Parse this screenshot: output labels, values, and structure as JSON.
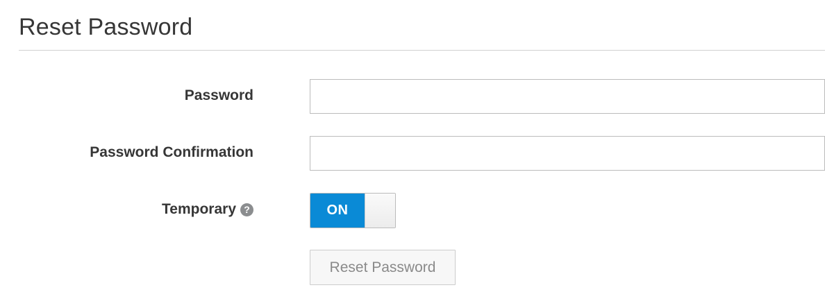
{
  "header": {
    "title": "Reset Password"
  },
  "form": {
    "password": {
      "label": "Password",
      "value": "",
      "placeholder": ""
    },
    "password_confirmation": {
      "label": "Password Confirmation",
      "value": "",
      "placeholder": ""
    },
    "temporary": {
      "label": "Temporary",
      "help_icon": "question-circle-icon",
      "help_glyph": "?",
      "toggle_label": "ON",
      "state": true
    },
    "submit": {
      "label": "Reset Password",
      "disabled": true
    }
  },
  "colors": {
    "toggle_on": "#0a8ad6",
    "text": "#363636",
    "button_disabled_text": "#8a8a8a"
  }
}
